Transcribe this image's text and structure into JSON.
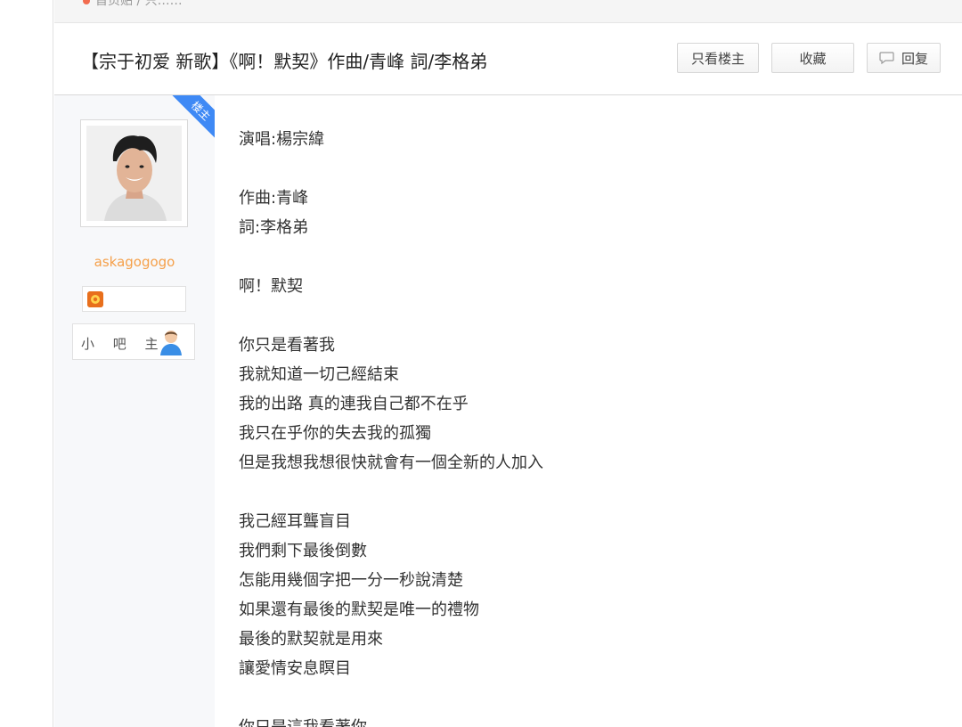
{
  "breadcrumb": {
    "text": "首页贴 / 只……"
  },
  "thread": {
    "title": "【宗于初爱 新歌】《啊！默契》作曲/青峰 詞/李格弟",
    "buttons": {
      "only_op": "只看楼主",
      "favorite": "收藏",
      "reply": "回复"
    }
  },
  "author": {
    "op_badge": "楼主",
    "username": "askagogogo",
    "role": "小 吧 主",
    "icons": {
      "level": "level-badge-icon",
      "role": "user-silhouette-icon",
      "avatar": "avatar-photo"
    }
  },
  "post": {
    "lines": [
      "演唱:楊宗緯",
      "",
      "作曲:青峰",
      "詞:李格弟",
      "",
      "啊！默契",
      "",
      "你只是看著我",
      "我就知道一切己經結束",
      "我的出路 真的連我自己都不在乎",
      "我只在乎你的失去我的孤獨",
      "但是我想我想很快就會有一個全新的人加入",
      "",
      "我己經耳聾盲目",
      "我們剩下最後倒數",
      "怎能用幾個字把一分一秒說清楚",
      "如果還有最後的默契是唯一的禮物",
      "最後的默契就是用來",
      "讓愛情安息瞑目",
      "",
      "你只是這我看著你"
    ]
  },
  "colors": {
    "op_badge_bg": "#3e89f5",
    "username": "#f5a04a",
    "level_icon": "#e86f1c"
  }
}
